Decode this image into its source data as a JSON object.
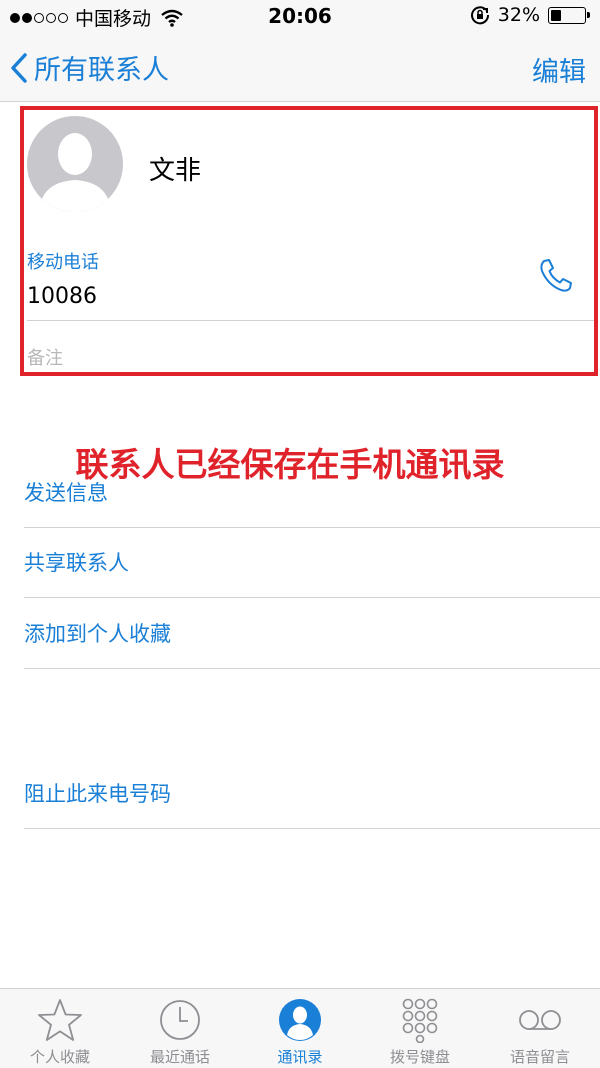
{
  "status_bar": {
    "carrier": "中国移动",
    "time": "20:06",
    "battery_percent": "32%",
    "battery_level": 0.32
  },
  "nav": {
    "back_label": "所有联系人",
    "edit_label": "编辑"
  },
  "contact": {
    "name": "文非",
    "phone_label": "移动电话",
    "phone_number": "10086",
    "notes_label": "备注"
  },
  "annotation": "联系人已经保存在手机通讯录",
  "actions": {
    "send_message": "发送信息",
    "share_contact": "共享联系人",
    "add_to_favorites": "添加到个人收藏",
    "block_caller": "阻止此来电号码"
  },
  "tab_bar": {
    "tabs": [
      {
        "label": "个人收藏",
        "icon": "star-icon"
      },
      {
        "label": "最近通话",
        "icon": "clock-icon"
      },
      {
        "label": "通讯录",
        "icon": "contacts-icon",
        "active": true
      },
      {
        "label": "拨号键盘",
        "icon": "keypad-icon"
      },
      {
        "label": "语音留言",
        "icon": "voicemail-icon"
      }
    ]
  },
  "colors": {
    "accent": "#1a7fd6",
    "highlight_red": "#e0232b"
  }
}
